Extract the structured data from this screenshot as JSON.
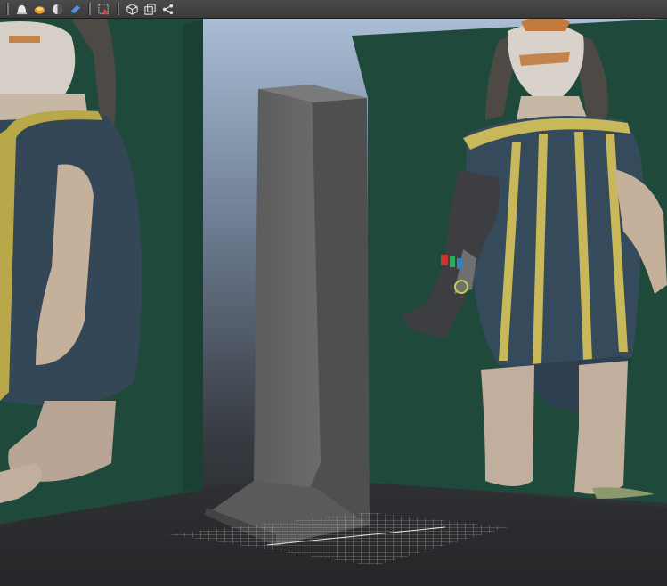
{
  "toolbar": {
    "buttons": [
      {
        "name": "smooth-shade-icon",
        "group": 1
      },
      {
        "name": "textured-shade-icon",
        "group": 1
      },
      {
        "name": "lighting-icon",
        "group": 1
      },
      {
        "name": "shadows-icon",
        "group": 1
      },
      {
        "name": "xray-select-icon",
        "group": 2
      },
      {
        "name": "camera-cube-icon",
        "group": 3
      },
      {
        "name": "isolate-view-icon",
        "group": 3
      },
      {
        "name": "node-graph-icon",
        "group": 3
      }
    ]
  },
  "viewport": {
    "background_top": "#9db2cc",
    "background_bottom": "#2b2d31",
    "wall_color": "#1e4a3a",
    "pillar_color": "#6a6a6a",
    "floor_color": "#2a2b2d"
  }
}
